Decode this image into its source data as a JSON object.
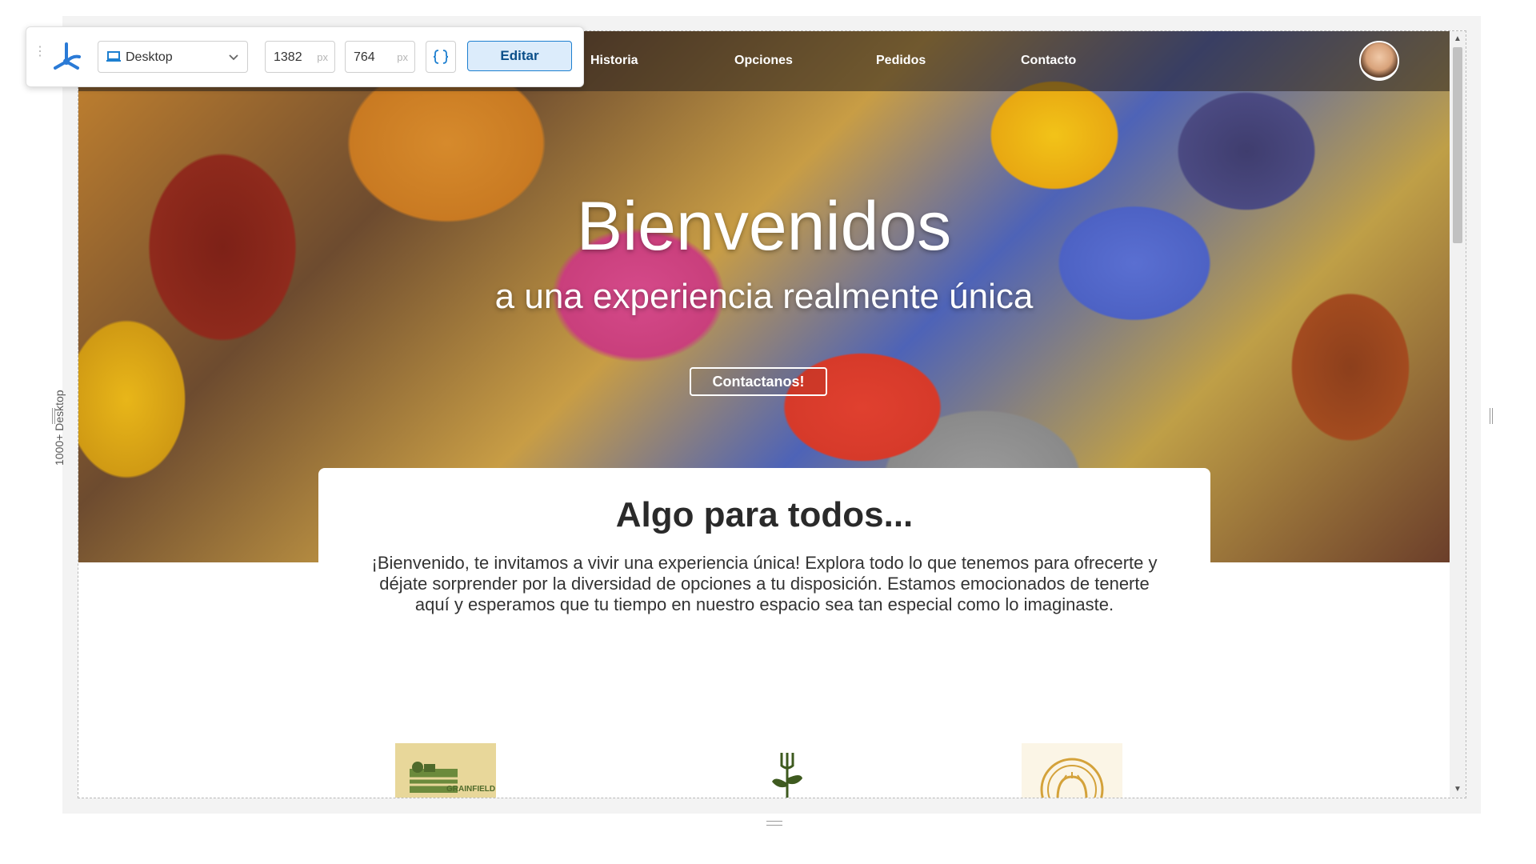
{
  "toolbar": {
    "device": "Desktop",
    "width": "1382",
    "height": "764",
    "unit": "px",
    "edit_label": "Editar"
  },
  "side": {
    "label": "1000+ Desktop"
  },
  "nav": {
    "items": [
      "Historia",
      "Opciones",
      "Pedidos",
      "Contacto"
    ]
  },
  "hero": {
    "title": "Bienvenidos",
    "subtitle": "a una experiencia realmente única",
    "cta": "Contactanos!"
  },
  "intro": {
    "heading": "Algo para todos...",
    "text": "¡Bienvenido, te invitamos a vivir una experiencia única! Explora todo lo que tenemos para ofrecerte y déjate sorprender por la diversidad de opciones a tu disposición. Estamos emocionados de tenerte aquí y esperamos que tu tiempo en nuestro espacio sea tan especial como lo imaginaste."
  },
  "logos": [
    {
      "text": "GRAINFIELD",
      "icon": "farm-logo-icon"
    },
    {
      "icon": "plant-logo-icon"
    },
    {
      "icon": "oven-logo-icon"
    }
  ],
  "colors": {
    "accent": "#1d7fd0",
    "edit_bg": "#dcecfb"
  }
}
